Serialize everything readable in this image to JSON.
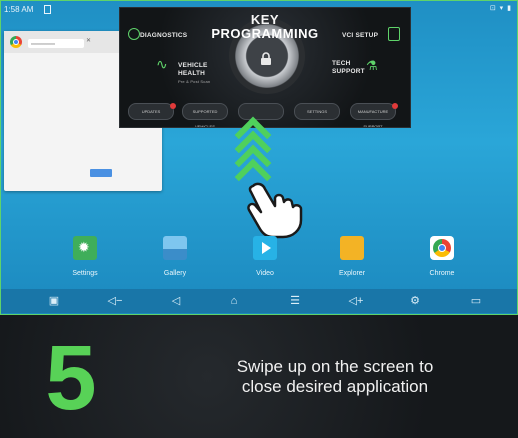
{
  "status_bar": {
    "time": "1:58 AM",
    "right_indicators": "⊡ ▾ ▮"
  },
  "recent_card": {
    "tab_title": "xxxxxxxxxxxx"
  },
  "key_programming_app": {
    "title_line1": "KEY",
    "title_line2": "PROGRAMMING",
    "diagnostics": "DIAGNOSTICS",
    "vci_setup": "VCI SETUP",
    "vehicle_health_1": "VEHICLE",
    "vehicle_health_2": "HEALTH",
    "vehicle_health_sub": "Pre & Post Scan",
    "tech_support_1": "TECH",
    "tech_support_2": "SUPPORT",
    "bottom_buttons": [
      "UPDATES",
      "SUPPORTED VEHICLES",
      "",
      "SETTINGS",
      "MANUFACTURE SUPPORT"
    ]
  },
  "home_apps": [
    {
      "label": "Settings",
      "icon": "settings-icon"
    },
    {
      "label": "Gallery",
      "icon": "gallery-icon"
    },
    {
      "label": "Video",
      "icon": "video-icon"
    },
    {
      "label": "Explorer",
      "icon": "explorer-icon"
    },
    {
      "label": "Chrome",
      "icon": "chrome-icon"
    }
  ],
  "nav_icons": [
    "screenshot-icon",
    "volume-down-icon",
    "back-icon",
    "home-icon",
    "menu-icon",
    "volume-up-icon",
    "vci-icon",
    "recent-apps-icon"
  ],
  "colors": {
    "accent_green": "#58d257",
    "screen_blue": "#2aa6d8",
    "panel_dark": "#1a1d20"
  },
  "step": {
    "number": "5",
    "line1": "Swipe up on the screen to",
    "line2": "close desired application"
  }
}
